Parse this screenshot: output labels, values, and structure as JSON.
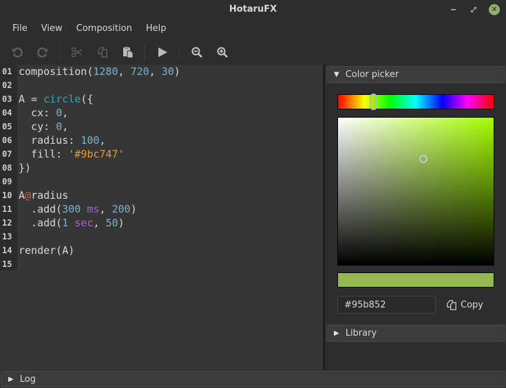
{
  "window": {
    "title": "HotaruFX",
    "controls": {
      "minimize": "minimize-icon",
      "maximize": "restore-icon",
      "close": "close-icon",
      "close_color": "#8fb36b"
    }
  },
  "menu": {
    "items": [
      "File",
      "View",
      "Composition",
      "Help"
    ]
  },
  "toolbar": {
    "buttons": [
      {
        "name": "undo",
        "icon": "undo-icon",
        "enabled": false
      },
      {
        "name": "redo",
        "icon": "redo-icon",
        "enabled": false
      },
      {
        "name": "cut",
        "icon": "scissors-icon",
        "enabled": false
      },
      {
        "name": "copy",
        "icon": "copy-icon",
        "enabled": false
      },
      {
        "name": "paste",
        "icon": "paste-icon",
        "enabled": true
      },
      {
        "name": "play",
        "icon": "play-icon",
        "enabled": true
      },
      {
        "name": "zoom-out",
        "icon": "zoom-out-icon",
        "enabled": true
      },
      {
        "name": "zoom-in",
        "icon": "zoom-in-icon",
        "enabled": true
      }
    ]
  },
  "editor": {
    "line_numbers": [
      "01",
      "02",
      "03",
      "04",
      "05",
      "06",
      "07",
      "08",
      "09",
      "10",
      "11",
      "12",
      "13",
      "14",
      "15"
    ],
    "lines": [
      [
        {
          "t": "composition(",
          "c": ""
        },
        {
          "t": "1280",
          "c": "num"
        },
        {
          "t": ", ",
          "c": ""
        },
        {
          "t": "720",
          "c": "num"
        },
        {
          "t": ", ",
          "c": ""
        },
        {
          "t": "30",
          "c": "num"
        },
        {
          "t": ")",
          "c": ""
        }
      ],
      [],
      [
        {
          "t": "A = ",
          "c": ""
        },
        {
          "t": "circle",
          "c": "fn"
        },
        {
          "t": "({",
          "c": ""
        }
      ],
      [
        {
          "t": "  cx: ",
          "c": ""
        },
        {
          "t": "0",
          "c": "num"
        },
        {
          "t": ",",
          "c": ""
        }
      ],
      [
        {
          "t": "  cy: ",
          "c": ""
        },
        {
          "t": "0",
          "c": "num"
        },
        {
          "t": ",",
          "c": ""
        }
      ],
      [
        {
          "t": "  radius: ",
          "c": ""
        },
        {
          "t": "100",
          "c": "num"
        },
        {
          "t": ",",
          "c": ""
        }
      ],
      [
        {
          "t": "  fill: ",
          "c": ""
        },
        {
          "t": "'#9bc747'",
          "c": "str"
        }
      ],
      [
        {
          "t": "})",
          "c": ""
        }
      ],
      [],
      [
        {
          "t": "A",
          "c": ""
        },
        {
          "t": "@",
          "c": "at"
        },
        {
          "t": "radius",
          "c": ""
        }
      ],
      [
        {
          "t": "  .add(",
          "c": ""
        },
        {
          "t": "300",
          "c": "num"
        },
        {
          "t": " ",
          "c": ""
        },
        {
          "t": "ms",
          "c": "unit"
        },
        {
          "t": ", ",
          "c": ""
        },
        {
          "t": "200",
          "c": "num"
        },
        {
          "t": ")",
          "c": ""
        }
      ],
      [
        {
          "t": "  .add(",
          "c": ""
        },
        {
          "t": "1",
          "c": "num"
        },
        {
          "t": " ",
          "c": ""
        },
        {
          "t": "sec",
          "c": "unit"
        },
        {
          "t": ", ",
          "c": ""
        },
        {
          "t": "50",
          "c": "num"
        },
        {
          "t": ")",
          "c": ""
        }
      ],
      [],
      [
        {
          "t": "render(A)",
          "c": ""
        }
      ],
      []
    ],
    "colors": {
      "number": "#7fb0cc",
      "function": "#2fa7c4",
      "string": "#e69a3a",
      "unit": "#a660d8",
      "at": "#e05555"
    }
  },
  "color_picker": {
    "header": "Color picker",
    "expanded": true,
    "hue_color": "#a4ff00",
    "hue_fraction": 0.23,
    "saturation_fraction": 0.55,
    "value_fraction": 0.72,
    "preview_color": "#95b852",
    "hex_value": "#95b852",
    "copy_label": "Copy"
  },
  "library": {
    "header": "Library",
    "expanded": false
  },
  "log": {
    "header": "Log",
    "expanded": false
  }
}
